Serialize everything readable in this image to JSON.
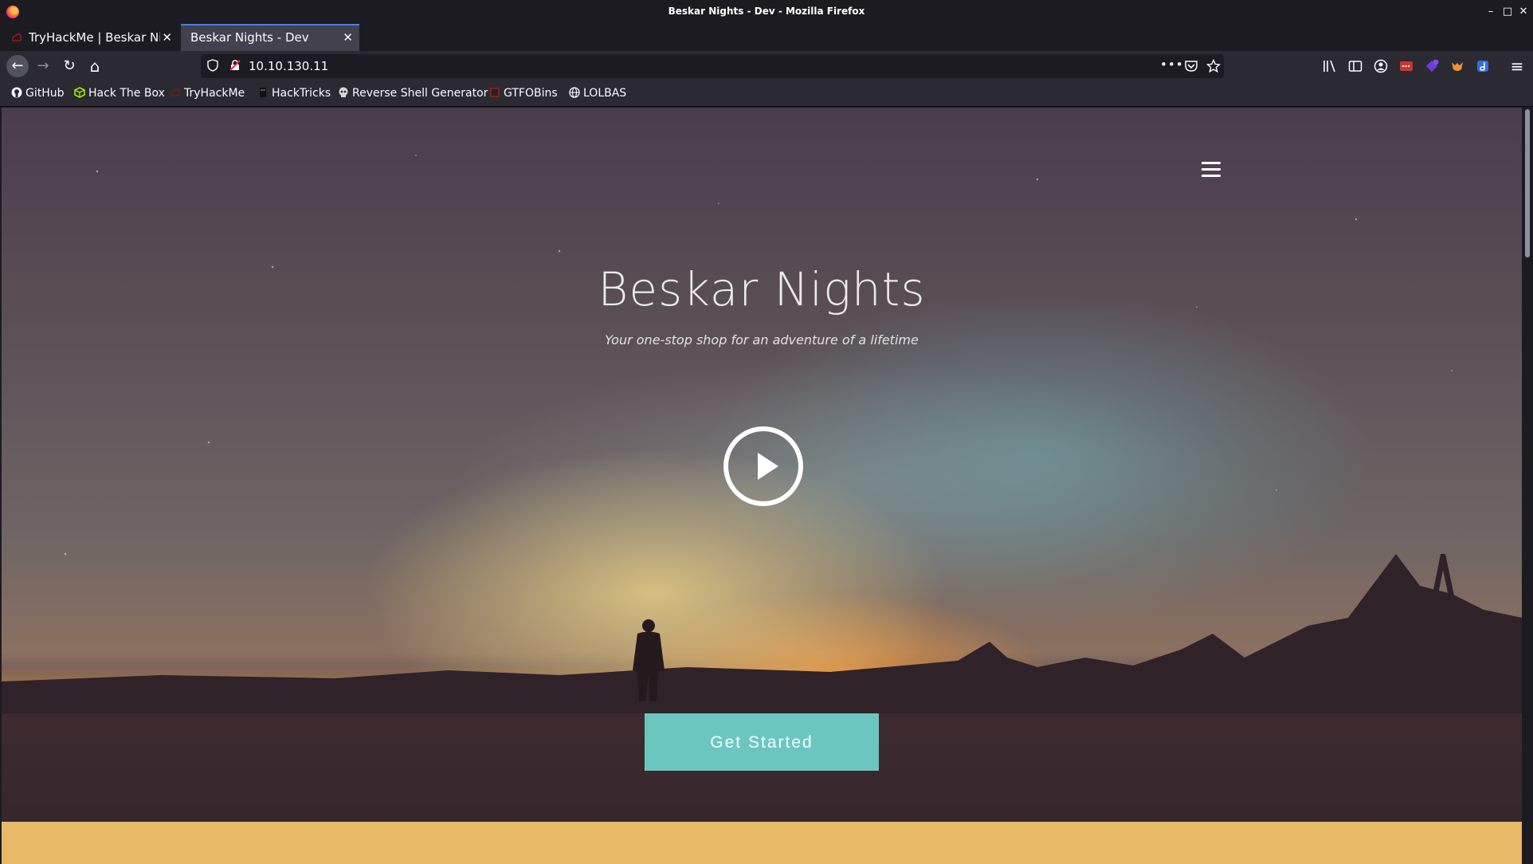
{
  "window": {
    "title": "Beskar Nights - Dev - Mozilla Firefox",
    "controls": {
      "minimize": "–",
      "maximize": "□",
      "close": "✕"
    }
  },
  "tabs": [
    {
      "label": "TryHackMe | Beskar Nigh",
      "active": false,
      "close": "✕"
    },
    {
      "label": "Beskar Nights - Dev",
      "active": true,
      "close": "✕"
    }
  ],
  "new_tab": "+",
  "nav": {
    "back": "←",
    "forward": "→",
    "reload": "↻",
    "home": "⌂",
    "url": "10.10.130.11",
    "page_actions": "•••",
    "menu": "≡"
  },
  "bookmarks": [
    {
      "label": "GitHub",
      "icon": "github-icon"
    },
    {
      "label": "Hack The Box",
      "icon": "htb-icon"
    },
    {
      "label": "TryHackMe",
      "icon": "tryhackme-icon"
    },
    {
      "label": "HackTricks",
      "icon": "hacktricks-icon"
    },
    {
      "label": "Reverse Shell Generator",
      "icon": "skull-icon"
    },
    {
      "label": "GTFOBins",
      "icon": "gtfobins-icon"
    },
    {
      "label": "LOLBAS",
      "icon": "globe-icon"
    }
  ],
  "hero": {
    "title": "Beskar Nights",
    "subtitle": "Your one-stop shop for an adventure of a lifetime",
    "cta": "Get Started"
  },
  "colors": {
    "cta": "#6cc6c0",
    "band": "#e8b967",
    "tab_active_border": "#3b82f6"
  }
}
